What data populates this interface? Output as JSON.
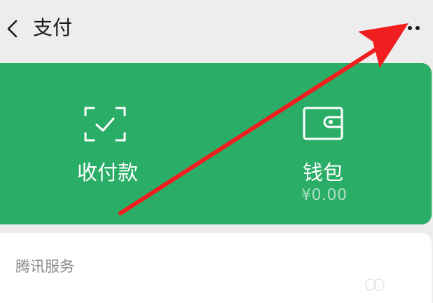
{
  "header": {
    "back_icon": "chevron-left-icon",
    "title": "支付",
    "more_icon": "more-horizontal-icon"
  },
  "actions": {
    "pay": {
      "icon": "scan-check-icon",
      "label": "收付款"
    },
    "wallet": {
      "icon": "wallet-icon",
      "label": "钱包",
      "balance": "¥0.00"
    }
  },
  "services": {
    "title": "腾讯服务"
  },
  "annotation": {
    "arrow_icon": "red-arrow-annotation",
    "color": "#f01e1e"
  },
  "colors": {
    "background": "#ededed",
    "card_green": "#2aae67",
    "text_dark": "#1a1a1a",
    "text_muted": "#8a8a8a"
  }
}
